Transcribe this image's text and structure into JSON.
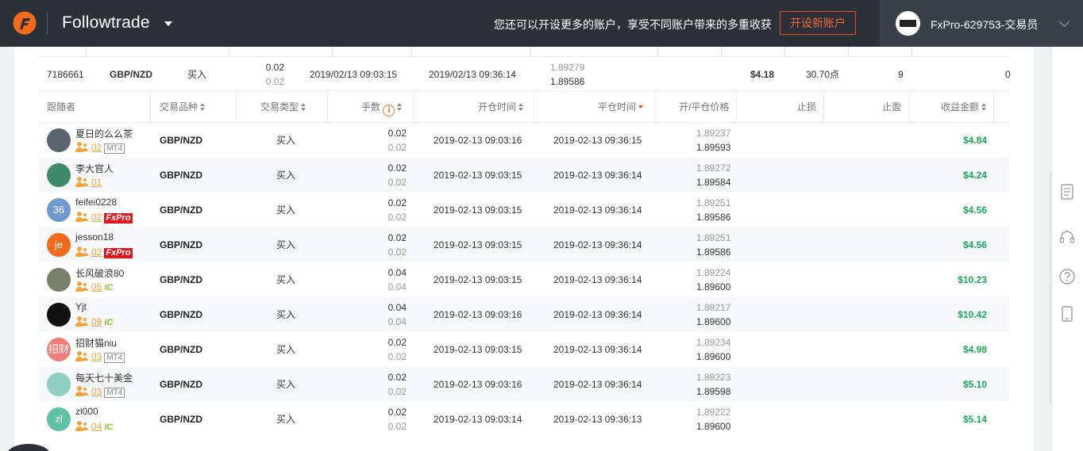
{
  "header": {
    "brand": "Followtrade",
    "promo": "您还可以开设更多的账户，享受不同账户带来的多重收获",
    "open_account_button": "开设新账户",
    "account_name": "FxPro-629753-交易员"
  },
  "leader_row": {
    "ticket": "7186661",
    "symbol": "GBP/NZD",
    "type": "买入",
    "lots": "0.02",
    "lots_sub": "0.02",
    "open_time": "2019/02/13 09:03:15",
    "close_time": "2019/02/13 09:36:14",
    "open_price": "1.89279",
    "close_price": "1.89586",
    "profit": "$4.18",
    "points": "30.70点",
    "followers": "9",
    "extra": "0"
  },
  "columns": {
    "follower": "跟随者",
    "symbol": "交易品种",
    "type": "交易类型",
    "lots": "手数",
    "open_time": "开仓时间",
    "close_time": "平仓时间",
    "price": "开/平仓价格",
    "stop_loss": "止损",
    "take_profit": "止盈",
    "profit": "收益金额"
  },
  "rows": [
    {
      "name": "夏日的么么茶",
      "count": "02",
      "tag": "MT4",
      "avatar_text": "",
      "avatar_color": "#5a6470",
      "symbol": "GBP/NZD",
      "type": "买入",
      "lots": "0.02",
      "lots_sub": "0.02",
      "open_time": "2019-02-13 09:03:16",
      "close_time": "2019-02-13 09:36:15",
      "open_price": "1.89237",
      "close_price": "1.89593",
      "profit": "$4.84"
    },
    {
      "name": "李大官人",
      "count": "01",
      "tag": "",
      "avatar_text": "",
      "avatar_color": "#3f8a6a",
      "symbol": "GBP/NZD",
      "type": "买入",
      "lots": "0.02",
      "lots_sub": "0.02",
      "open_time": "2019-02-13 09:03:15",
      "close_time": "2019-02-13 09:36:14",
      "open_price": "1.89272",
      "close_price": "1.89584",
      "profit": "$4.24"
    },
    {
      "name": "feifei0228",
      "count": "02",
      "tag": "FxPro",
      "avatar_text": "36",
      "avatar_color": "#6f9bd1",
      "symbol": "GBP/NZD",
      "type": "买入",
      "lots": "0.02",
      "lots_sub": "0.02",
      "open_time": "2019-02-13 09:03:15",
      "close_time": "2019-02-13 09:36:14",
      "open_price": "1.89251",
      "close_price": "1.89586",
      "profit": "$4.56"
    },
    {
      "name": "jesson18",
      "count": "02",
      "tag": "FxPro",
      "avatar_text": "je",
      "avatar_color": "#f26a1b",
      "symbol": "GBP/NZD",
      "type": "买入",
      "lots": "0.02",
      "lots_sub": "0.02",
      "open_time": "2019-02-13 09:03:15",
      "close_time": "2019-02-13 09:36:14",
      "open_price": "1.89251",
      "close_price": "1.89586",
      "profit": "$4.56"
    },
    {
      "name": "长风破浪80",
      "count": "05",
      "tag": "IC",
      "avatar_text": "",
      "avatar_color": "#7a7f6a",
      "symbol": "GBP/NZD",
      "type": "买入",
      "lots": "0.04",
      "lots_sub": "0.04",
      "open_time": "2019-02-13 09:03:15",
      "close_time": "2019-02-13 09:36:14",
      "open_price": "1.89224",
      "close_price": "1.89600",
      "profit": "$10.23"
    },
    {
      "name": "Yjt",
      "count": "09",
      "tag": "IC",
      "avatar_text": "",
      "avatar_color": "#111111",
      "symbol": "GBP/NZD",
      "type": "买入",
      "lots": "0.04",
      "lots_sub": "0.04",
      "open_time": "2019-02-13 09:03:16",
      "close_time": "2019-02-13 09:36:14",
      "open_price": "1.89217",
      "close_price": "1.89600",
      "profit": "$10.42"
    },
    {
      "name": "招财猫niu",
      "count": "03",
      "tag": "MT4",
      "avatar_text": "招财",
      "avatar_color": "#f07e7a",
      "symbol": "GBP/NZD",
      "type": "买入",
      "lots": "0.02",
      "lots_sub": "0.02",
      "open_time": "2019-02-13 09:03:15",
      "close_time": "2019-02-13 09:36:14",
      "open_price": "1.89234",
      "close_price": "1.89600",
      "profit": "$4.98"
    },
    {
      "name": "每天七十美金",
      "count": "03",
      "tag": "MT4",
      "avatar_text": "",
      "avatar_color": "#8ecfc0",
      "symbol": "GBP/NZD",
      "type": "买入",
      "lots": "0.02",
      "lots_sub": "0.02",
      "open_time": "2019-02-13 09:03:16",
      "close_time": "2019-02-13 09:36:14",
      "open_price": "1.89223",
      "close_price": "1.89598",
      "profit": "$5.10"
    },
    {
      "name": "zl000",
      "count": "04",
      "tag": "IC",
      "avatar_text": "zl",
      "avatar_color": "#5fc1a6",
      "symbol": "GBP/NZD",
      "type": "买入",
      "lots": "0.02",
      "lots_sub": "0.02",
      "open_time": "2019-02-13 09:03:14",
      "close_time": "2019-02-13 09:36:13",
      "open_price": "1.89222",
      "close_price": "1.89600",
      "profit": "$5.14"
    }
  ],
  "colors": {
    "header_bg": "#2b3039",
    "accent": "#e8512a",
    "profit": "#1aaa55",
    "follower_count": "#f2a33a"
  },
  "icons": [
    "brand-logo-icon",
    "chevron-down-icon",
    "sort-icon",
    "info-icon",
    "people-icon",
    "document-icon",
    "headset-icon",
    "help-icon",
    "mobile-icon"
  ]
}
